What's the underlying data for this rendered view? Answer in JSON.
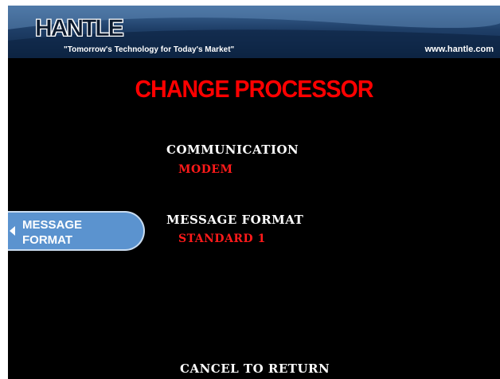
{
  "header": {
    "logo": "HANTLE",
    "tagline": "\"Tomorrow's Technology for Today's Market\"",
    "website": "www.hantle.com"
  },
  "title": "CHANGE PROCESSOR",
  "fields": [
    {
      "label": "COMMUNICATION",
      "value": "MODEM"
    },
    {
      "label": "MESSAGE FORMAT",
      "value": "STANDARD 1"
    }
  ],
  "side_button": {
    "line1": "MESSAGE",
    "line2": "FORMAT"
  },
  "footer": {
    "cancel": "CANCEL TO RETURN"
  },
  "colors": {
    "background": "#000000",
    "title": "#ff0000",
    "value": "#ff1a1a",
    "button": "#5b93cf",
    "header": "#1f3f68"
  }
}
